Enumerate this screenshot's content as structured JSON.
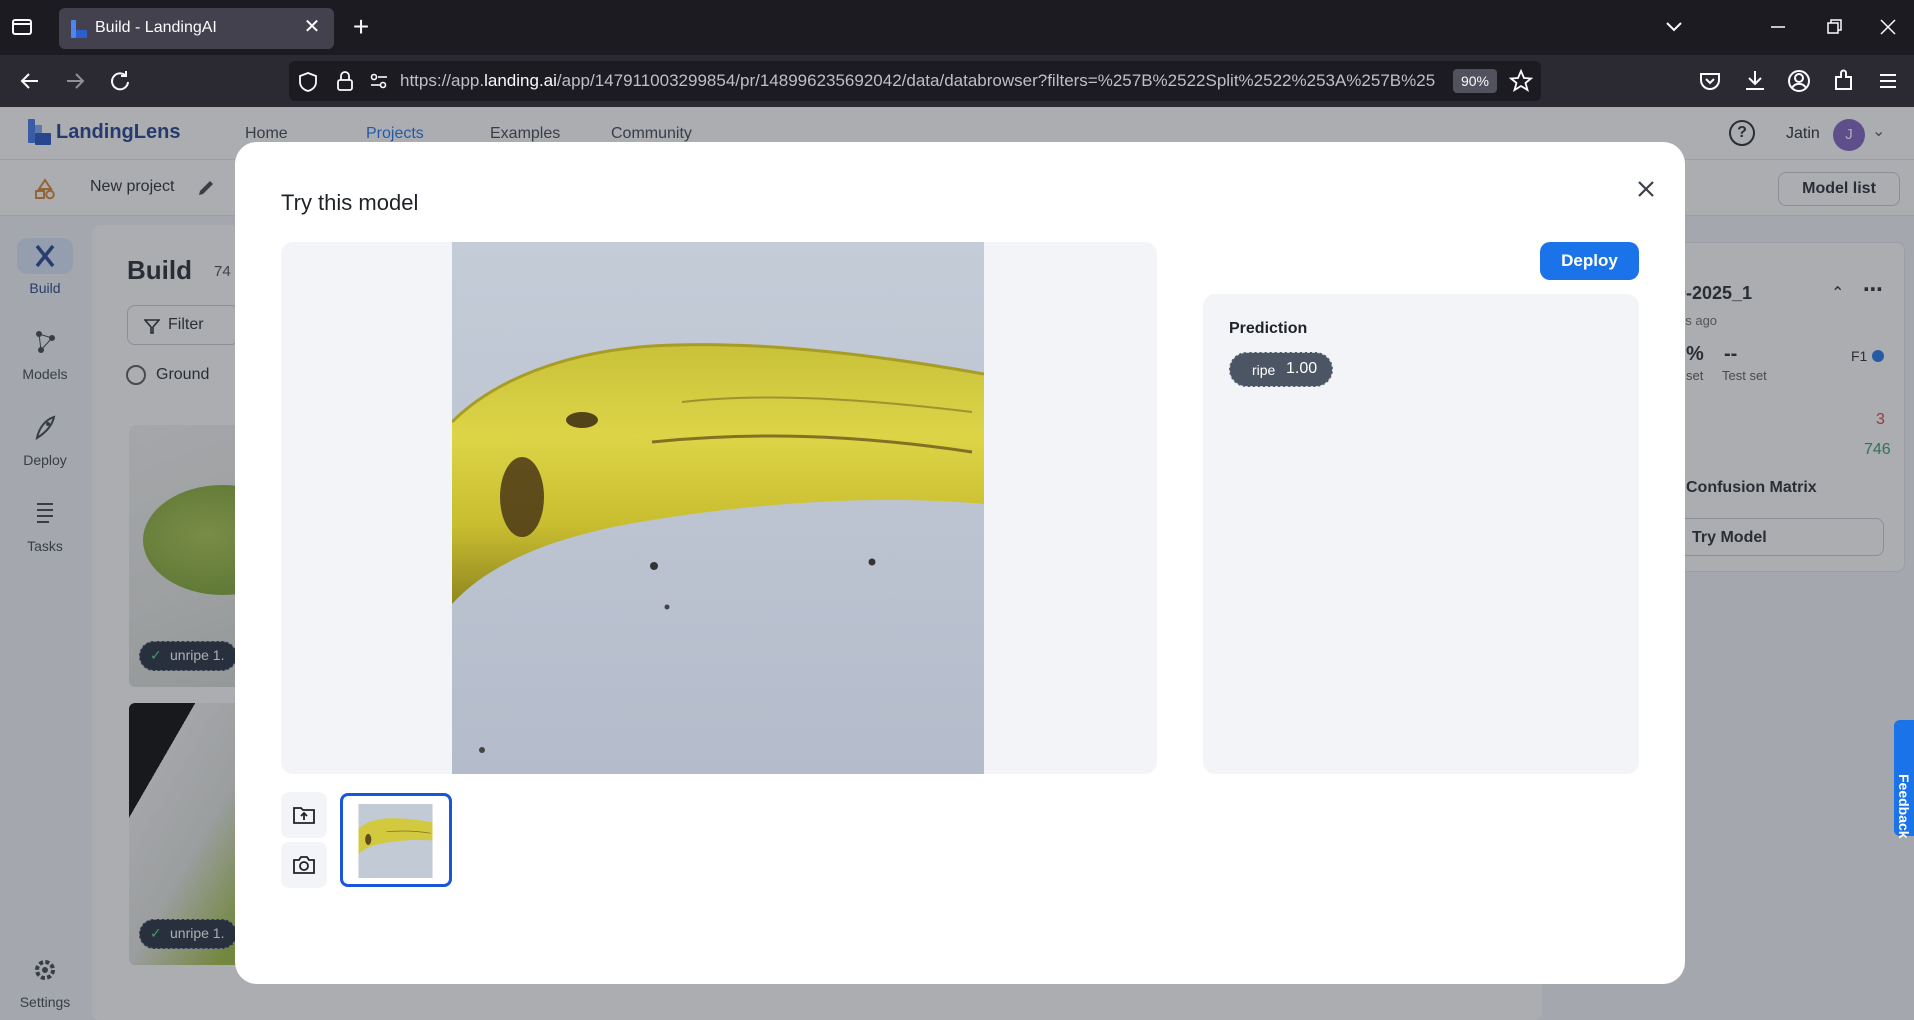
{
  "browser": {
    "tab_title": "Build - LandingAI",
    "url_prefix": "https://app.",
    "url_host": "landing.ai",
    "url_rest": "/app/147911003299854/pr/148996235692042/data/databrowser?filters=%257B%2522Split%2522%253A%257B%25",
    "zoom": "90%"
  },
  "app": {
    "logo_text": "LandingLens",
    "nav": [
      "Home",
      "Projects",
      "Examples",
      "Community"
    ],
    "active_nav": "Projects",
    "help_label": "?",
    "user_name": "Jatin",
    "user_initial": "J",
    "project_name": "New project",
    "model_list_label": "Model list",
    "sidebar": [
      "Build",
      "Models",
      "Deploy",
      "Tasks"
    ],
    "settings_label": "Settings",
    "build_title": "Build",
    "build_count": "74",
    "filter_label": "Filter",
    "ground_truth_label": "Ground",
    "thumb_chip_1": "unripe  1.",
    "thumb_chip_2": "unripe  1.",
    "model_card": {
      "name_fragment": "0-2025_1",
      "time_fragment": "es ago",
      "percent_fragment": "%",
      "set_fragment": "set",
      "test_value": "--",
      "test_label": "Test set",
      "f1_label": "F1",
      "count_red": "3",
      "count_green": "746",
      "confusion_label": "Confusion Matrix",
      "try_model_label": "Try Model"
    },
    "feedback_label": "Feedback"
  },
  "modal": {
    "title": "Try this model",
    "deploy_label": "Deploy",
    "prediction_title": "Prediction",
    "prediction_label": "ripe",
    "prediction_score": "1.00"
  },
  "colors": {
    "accent": "#1a73e8",
    "selected_border": "#1a56db",
    "chip_bg": "#4b5563",
    "positive": "#2e9c5b",
    "negative": "#d93a3a"
  }
}
